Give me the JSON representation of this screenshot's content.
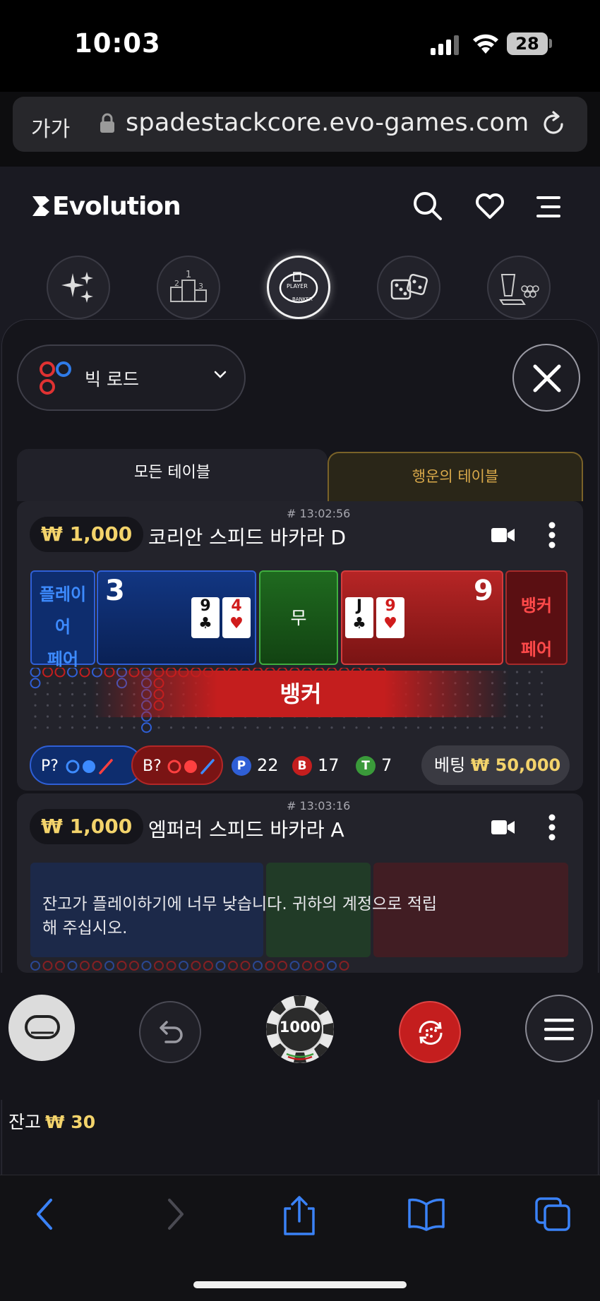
{
  "status": {
    "time": "10:03",
    "battery": "28"
  },
  "browser": {
    "text_size": "가가",
    "url": "spadestackcore.evo-games.com"
  },
  "app": {
    "brand": "Evolution"
  },
  "road_selector": {
    "label": "빅 로드"
  },
  "tabs": [
    {
      "label": "모든 테이블"
    },
    {
      "label": "행운의 테이블"
    }
  ],
  "tables": [
    {
      "timestamp": "# 13:02:56",
      "limit": "₩ 1,000",
      "name": "코리안 스피드 바카라 D",
      "player_pair": [
        "플레이",
        "어",
        "페어"
      ],
      "player_score": "3",
      "player_cards": [
        {
          "rank": "9",
          "suit": "♣"
        },
        {
          "rank": "4",
          "suit": "♥"
        }
      ],
      "tie_label": "무",
      "banker_score": "9",
      "banker_cards": [
        {
          "rank": "J",
          "suit": "♣"
        },
        {
          "rank": "9",
          "suit": "♥"
        }
      ],
      "banker_pair": [
        "뱅커",
        "페어"
      ],
      "result_banner": "뱅커",
      "player_predict": "P?",
      "banker_predict": "B?",
      "stats": {
        "p_badge": "P",
        "p_count": "22",
        "b_badge": "B",
        "b_count": "17",
        "t_badge": "T",
        "t_count": "7"
      },
      "bet_label": "베팅",
      "bet_amount": "₩ 50,000"
    },
    {
      "timestamp": "# 13:03:16",
      "limit": "₩ 1,000",
      "name": "엠퍼러 스피드 바카라 A",
      "message": "잔고가 플레이하기에 너무 낮습니다. 귀하의 계정으로 적립해 주십시오."
    }
  ],
  "controls": {
    "chip_value": "1000"
  },
  "balance": {
    "label": "잔고",
    "amount": "₩ 30"
  },
  "colors": {
    "gold": "#f3d36b",
    "player_blue": "#2f5fd6",
    "banker_red": "#c41e1e",
    "tie_green": "#3faf3f"
  }
}
